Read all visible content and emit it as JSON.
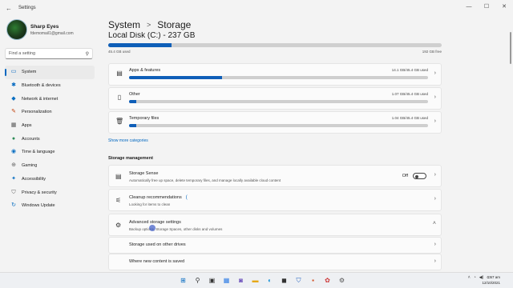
{
  "titlebar": {
    "app_title": "Settings",
    "back": "←",
    "minimize": "—",
    "maximize": "☐",
    "close": "✕"
  },
  "profile": {
    "name": "Sharp Eyes",
    "email": "fdemomail1@gmail.com"
  },
  "search": {
    "placeholder": "Find a setting"
  },
  "nav": [
    {
      "label": "System",
      "icon": "monitor-icon",
      "glyph": "▭",
      "color": "#0067c0",
      "active": true
    },
    {
      "label": "Bluetooth & devices",
      "icon": "bluetooth-icon",
      "glyph": "✱",
      "color": "#0067c0"
    },
    {
      "label": "Network & internet",
      "icon": "wifi-icon",
      "glyph": "◆",
      "color": "#0a6fc2"
    },
    {
      "label": "Personalization",
      "icon": "brush-icon",
      "glyph": "✎",
      "color": "#c2410c"
    },
    {
      "label": "Apps",
      "icon": "apps-icon",
      "glyph": "▦",
      "color": "#555555"
    },
    {
      "label": "Accounts",
      "icon": "person-icon",
      "glyph": "●",
      "color": "#2e8b57"
    },
    {
      "label": "Time & language",
      "icon": "globe-icon",
      "glyph": "◉",
      "color": "#0a6fc2"
    },
    {
      "label": "Gaming",
      "icon": "gamepad-icon",
      "glyph": "⊕",
      "color": "#666666"
    },
    {
      "label": "Accessibility",
      "icon": "accessibility-icon",
      "glyph": "✦",
      "color": "#0a6fc2"
    },
    {
      "label": "Privacy & security",
      "icon": "shield-icon",
      "glyph": "⛉",
      "color": "#666666"
    },
    {
      "label": "Windows Update",
      "icon": "update-icon",
      "glyph": "↻",
      "color": "#0a6fc2"
    }
  ],
  "header": {
    "parent": "System",
    "separator": ">",
    "current": "Storage"
  },
  "disk": {
    "title": "Local Disk (C:) - 237 GB",
    "used_label": "45.4 GB used",
    "free_label": "192 GB free",
    "used_fraction": 0.19
  },
  "categories": [
    {
      "label": "Apps & features",
      "size": "14.1 GB/45.4 GB used",
      "fraction": 0.31,
      "icon": "apps-features-icon",
      "glyph": "▤"
    },
    {
      "label": "Other",
      "size": "1.07 GB/45.4 GB used",
      "fraction": 0.024,
      "icon": "document-icon",
      "glyph": "▯"
    },
    {
      "label": "Temporary files",
      "size": "1.04 GB/45.4 GB used",
      "fraction": 0.023,
      "icon": "trash-icon",
      "glyph": "🗑"
    }
  ],
  "show_more": "Show more categories",
  "section_title": "Storage management",
  "storage_sense": {
    "title": "Storage Sense",
    "desc": "Automatically free up space, delete temporary files, and manage locally available cloud content",
    "toggle_label": "Off"
  },
  "cleanup": {
    "title": "Cleanup recommendations",
    "desc": "Looking for items to clean",
    "spinner": "("
  },
  "advanced": {
    "title": "Advanced storage settings",
    "desc": "Backup options, Storage Spaces, other disks and volumes",
    "expanded": true
  },
  "sub_items": [
    {
      "label": "Storage used on other drives"
    },
    {
      "label": "Where new content is saved"
    }
  ],
  "chevron_right": "›",
  "chevron_up": "˄",
  "tray": {
    "chevron": "˄",
    "wifi": "◔",
    "volume": "◀)",
    "battery": "▭"
  },
  "clock": {
    "time": "1:57 am",
    "date": "12/10/2021"
  },
  "taskbar_icons": [
    {
      "name": "start-icon",
      "glyph": "⊞",
      "color": "#0067c0"
    },
    {
      "name": "search-icon",
      "glyph": "⚲",
      "color": "#333333"
    },
    {
      "name": "task-view-icon",
      "glyph": "▣",
      "color": "#333333"
    },
    {
      "name": "widgets-icon",
      "glyph": "▦",
      "color": "#2c7be5"
    },
    {
      "name": "chat-icon",
      "glyph": "◙",
      "color": "#6b4fbb"
    },
    {
      "name": "file-explorer-icon",
      "glyph": "▬",
      "color": "#e6a817"
    },
    {
      "name": "edge-icon",
      "glyph": "◐",
      "color": "#0f8fd6"
    },
    {
      "name": "store-icon",
      "glyph": "◼",
      "color": "#333333"
    },
    {
      "name": "defender-icon",
      "glyph": "⛉",
      "color": "#1f5fbf"
    },
    {
      "name": "app-icon",
      "glyph": "▪",
      "color": "#d04a1c"
    },
    {
      "name": "app-icon-2",
      "glyph": "✿",
      "color": "#cc3333"
    },
    {
      "name": "settings-icon",
      "glyph": "⚙",
      "color": "#555555"
    }
  ]
}
